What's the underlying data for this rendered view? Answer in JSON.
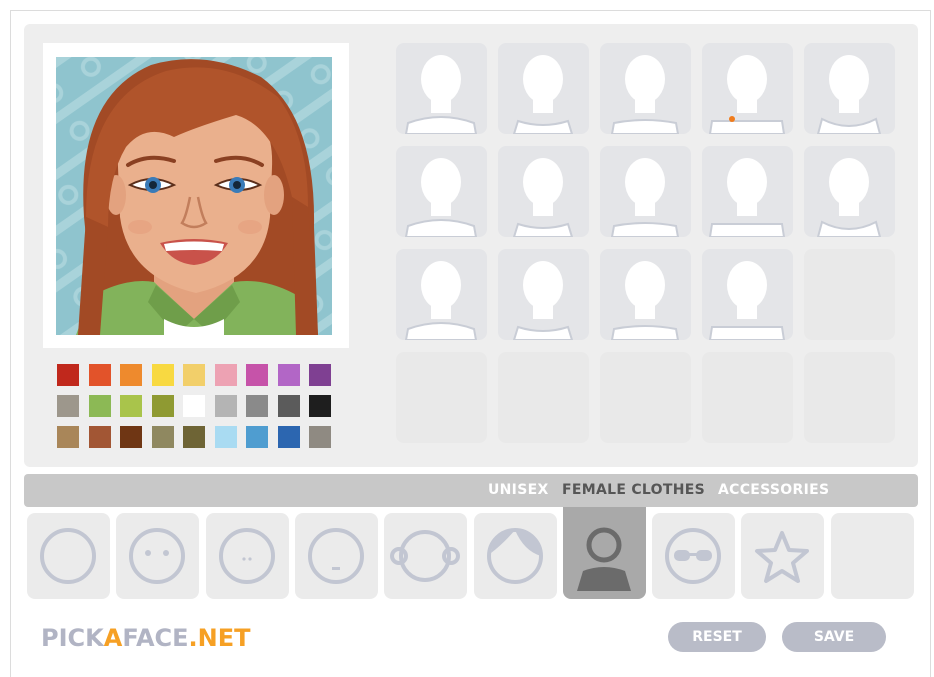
{
  "tabs": {
    "unisex": "UNISEX",
    "female_clothes": "FEMALE CLOTHES",
    "accessories": "ACCESSORIES"
  },
  "active_tab": "FEMALE CLOTHES",
  "logo": {
    "part1": "PICK",
    "part2": "A",
    "part3": "FACE",
    "part4": ".NET"
  },
  "buttons": {
    "reset": "RESET",
    "save": "SAVE"
  },
  "palette": [
    [
      "#c0281c",
      "#e2532a",
      "#ee8a2d",
      "#f8d941",
      "#f2cf6a",
      "#eda2b3",
      "#c653a9",
      "#b266c6",
      "#7f4092"
    ],
    [
      "#9d978c",
      "#8cb955",
      "#a9c44b",
      "#8f9a32",
      "#ffffff",
      "#b4b4b4",
      "#8a8a8a",
      "#5b5b5b",
      "#1e1e1e"
    ],
    [
      "#a98659",
      "#a25634",
      "#6f3614",
      "#8f8860",
      "#6e6435",
      "#a9dbf2",
      "#4f9dd0",
      "#2c66b0",
      "#8f8a82"
    ]
  ],
  "categories": [
    "face-shape-icon",
    "eyes-icon",
    "eyes-small-icon",
    "mouth-icon",
    "ears-icon",
    "hair-icon",
    "clothes-icon",
    "glasses-icon",
    "star-icon",
    "blank"
  ],
  "colors": {
    "logo_gray": "#b1b4c4",
    "logo_orange": "#f6a024",
    "button_bg": "#b9bcc8",
    "tab_bar": "#c8c8c8"
  }
}
